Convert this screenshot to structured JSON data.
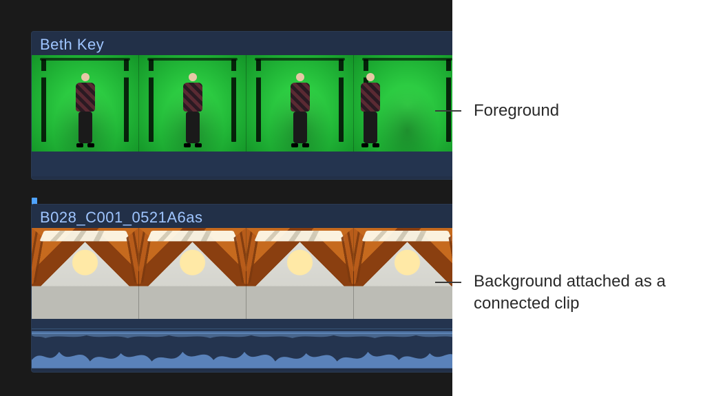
{
  "clips": {
    "foreground": {
      "title": "Beth Key"
    },
    "background": {
      "title": "B028_C001_0521A6as"
    }
  },
  "annotations": {
    "foreground": "Foreground",
    "background": "Background attached as a connected clip"
  }
}
